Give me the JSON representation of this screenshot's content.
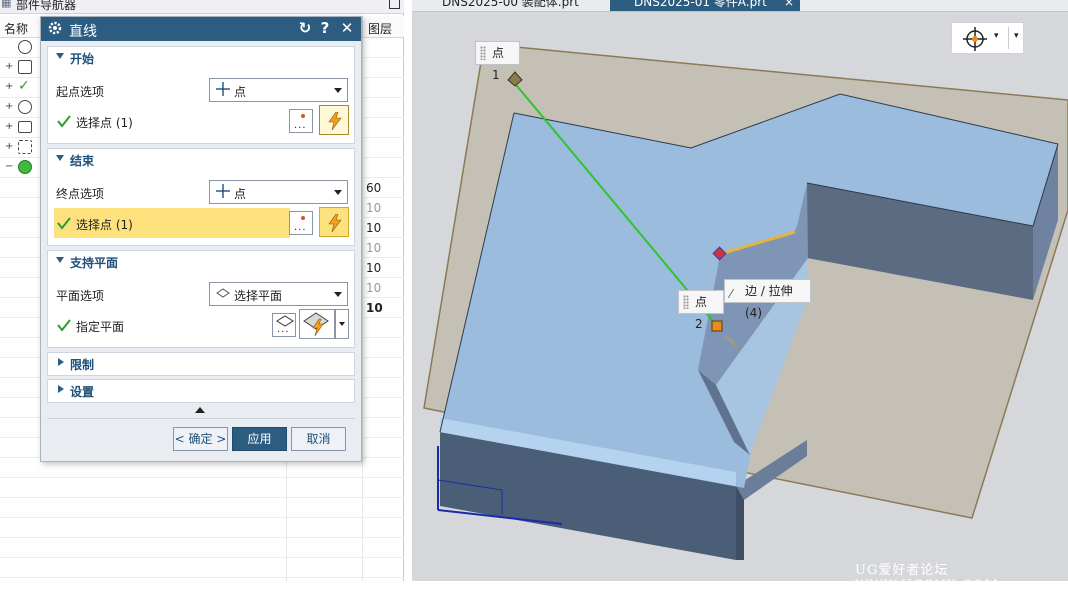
{
  "navigator": {
    "title": "部件导航器",
    "col_name": "名称",
    "col_layer": "图层",
    "layer_values": [
      "60",
      "10",
      "10",
      "10",
      "10",
      "10",
      "10"
    ]
  },
  "dialog": {
    "title": "直线",
    "start_group": {
      "label": "开始",
      "option_label": "起点选项",
      "option_value": "点",
      "select_label": "选择点 (1)"
    },
    "end_group": {
      "label": "结束",
      "option_label": "终点选项",
      "option_value": "点",
      "select_label": "选择点 (1)"
    },
    "support_group": {
      "label": "支持平面",
      "option_label": "平面选项",
      "option_value": "选择平面",
      "select_label": "指定平面"
    },
    "limits_group": {
      "label": "限制"
    },
    "settings_group": {
      "label": "设置"
    },
    "buttons": {
      "ok": "< 确定 >",
      "apply": "应用",
      "cancel": "取消"
    }
  },
  "viewport": {
    "tabs": [
      {
        "label": "DNS2025-00 装配体.prt"
      },
      {
        "label": "DNS2025-01 零件A.prt"
      }
    ],
    "labels": {
      "point1": "点 1",
      "point2": "点 2",
      "edge": "边 / 拉伸(4)"
    },
    "watermark": "UG爱好者论坛 WWW.UGSNX.COM",
    "colors": {
      "background": "#d5d7db",
      "face_top": "#9bbcdc",
      "face_side": "#4b5e78",
      "plane": "#b8ad96",
      "line": "#2fc52a"
    }
  }
}
